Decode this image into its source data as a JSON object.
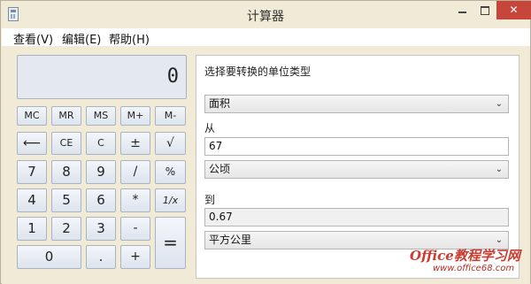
{
  "window": {
    "title": "计算器"
  },
  "menu": {
    "view": "查看(V)",
    "edit": "编辑(E)",
    "help": "帮助(H)"
  },
  "display": {
    "value": "0"
  },
  "keypad": {
    "mc": "MC",
    "mr": "MR",
    "ms": "MS",
    "mplus": "M+",
    "mminus": "M-",
    "backspace": "⟵",
    "ce": "CE",
    "c": "C",
    "plusminus": "±",
    "sqrt": "√",
    "n7": "7",
    "n8": "8",
    "n9": "9",
    "divide": "/",
    "percent": "%",
    "n4": "4",
    "n5": "5",
    "n6": "6",
    "multiply": "*",
    "reciprocal": "1/x",
    "n1": "1",
    "n2": "2",
    "n3": "3",
    "minus": "-",
    "equals": "=",
    "n0": "0",
    "dot": ".",
    "plus": "+"
  },
  "converter": {
    "type_label": "选择要转换的单位类型",
    "type_value": "面积",
    "from_label": "从",
    "from_value": "67",
    "from_unit": "公顷",
    "to_label": "到",
    "to_value": "0.67",
    "to_unit": "平方公里"
  },
  "watermark": {
    "main": "Office教程学习网",
    "url": "www.office68.com"
  },
  "icons": {
    "dropdown": "chevron-down-icon"
  }
}
